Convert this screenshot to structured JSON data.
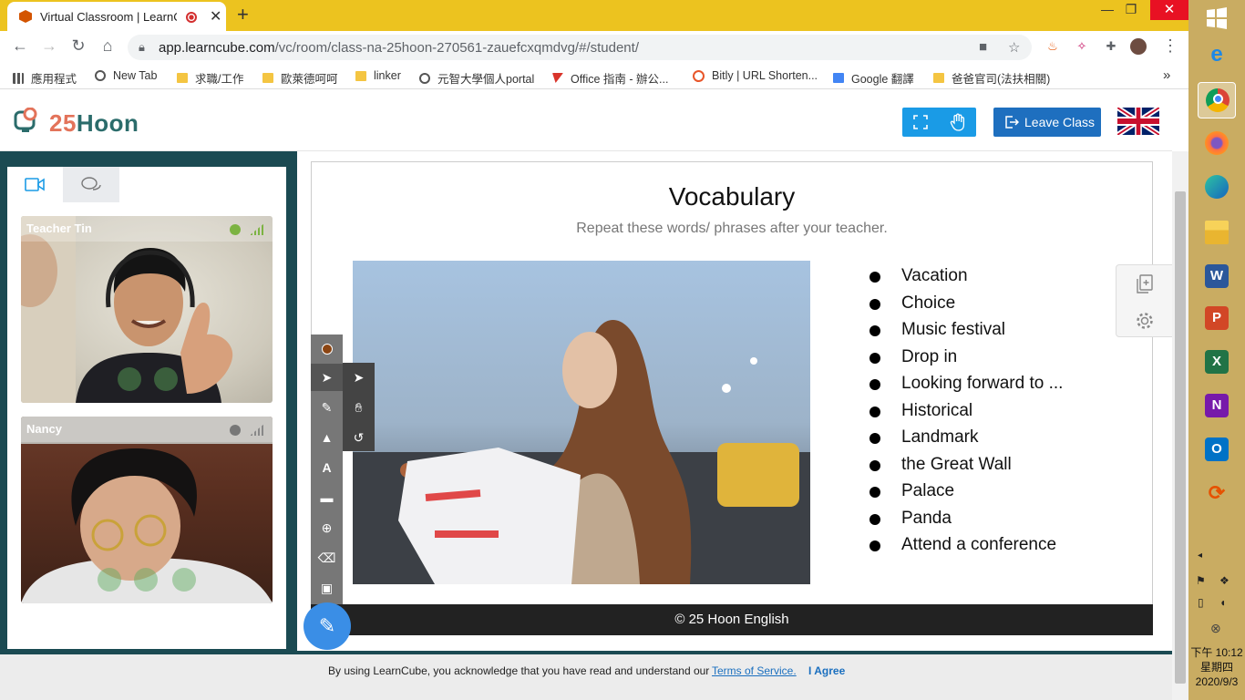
{
  "browser": {
    "tab_title": "Virtual Classroom | LearnCu",
    "new_tab": "+",
    "url_host": "app.learncube.com",
    "url_path": "/vc/room/class-na-25hoon-270561-zauefcxqmdvg/#/student/",
    "window_min": "—",
    "window_restore": "❐",
    "window_close": "✕"
  },
  "bookmarks": [
    {
      "label": "應用程式",
      "icon": "apps-icon"
    },
    {
      "label": "New Tab",
      "icon": "globe-icon"
    },
    {
      "label": "求職/工作",
      "icon": "folder-icon"
    },
    {
      "label": "歐萊德呵呵",
      "icon": "folder-icon"
    },
    {
      "label": "linker",
      "icon": "folder-icon"
    },
    {
      "label": "元智大學個人portal",
      "icon": "globe-icon"
    },
    {
      "label": "Office 指南 - 辦公...",
      "icon": "office-icon"
    },
    {
      "label": "Bitly | URL Shorten...",
      "icon": "bitly-icon"
    },
    {
      "label": "Google 翻譯",
      "icon": "translate-icon"
    },
    {
      "label": "爸爸官司(法扶相關)",
      "icon": "folder-icon"
    }
  ],
  "bookmarks_more": "»",
  "app": {
    "logo_num": "25",
    "logo_word": "Hoon",
    "leave_label": "Leave Class",
    "flag_icon": "uk-flag-icon"
  },
  "videos": [
    {
      "name": "Teacher Tin",
      "status_color": "#7cb342"
    },
    {
      "name": "Nancy",
      "status_color": "#777777"
    }
  ],
  "slide": {
    "title": "Vocabulary",
    "subtitle": "Repeat these words/ phrases after your teacher.",
    "vocab": [
      "Vacation",
      "Choice",
      "Music festival",
      "Drop in",
      "Looking forward to ...",
      "Historical",
      "Landmark",
      "the Great Wall",
      "Palace",
      "Panda",
      "Attend a conference"
    ],
    "footer": "© 25 Hoon English"
  },
  "consent": {
    "text": "By using LearnCube, you acknowledge that you have read and understand our",
    "tos": "Terms of Service.",
    "agree": "I Agree"
  },
  "taskbar": {
    "time": "下午 10:12",
    "weekday": "星期四",
    "date": "2020/9/3"
  },
  "colors": {
    "accent": "#1a9be6",
    "leave": "#1e6fbf",
    "chrome_frame": "#ecc31f",
    "classroom_bg": "#1b4a52"
  }
}
